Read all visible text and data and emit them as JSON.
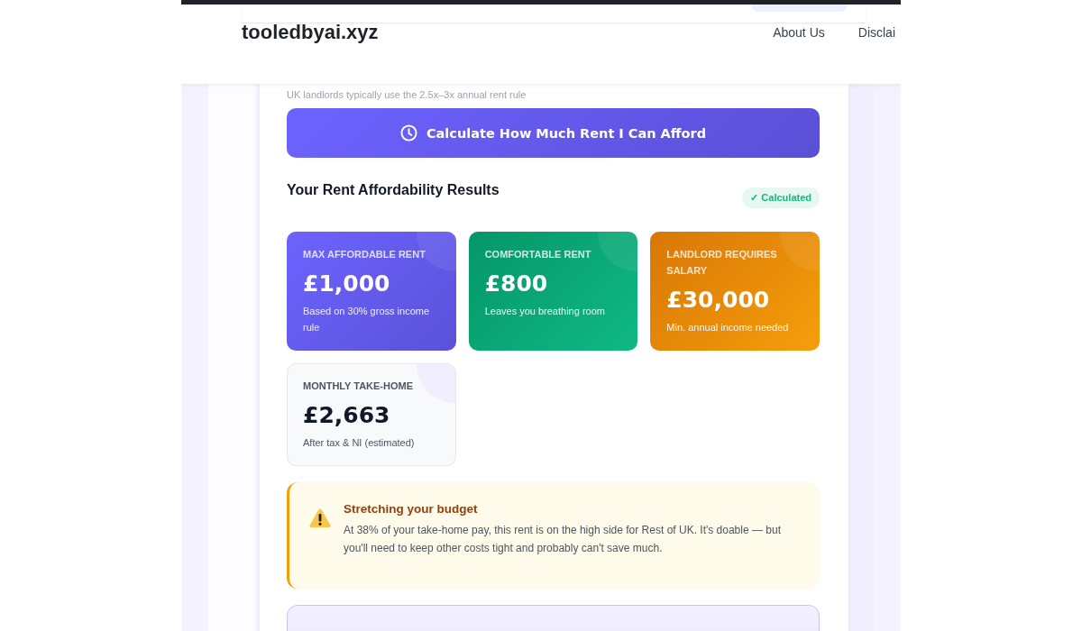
{
  "site_header": {
    "logo": "tooledbyai.xyz",
    "nav": [
      "About Us",
      "Disclai"
    ]
  },
  "calculator": {
    "hint": "UK landlords typically use the 2.5x–3x annual rent rule",
    "button": "Calculate How Much Rent I Can Afford"
  },
  "results": {
    "title": "Your Rent Affordability Results",
    "badge": "✓ Calculated",
    "cards": [
      {
        "kind": "primary",
        "label": "MAX AFFORDABLE RENT",
        "value": "£1,000",
        "note": "Based on 30% gross income rule"
      },
      {
        "kind": "success",
        "label": "COMFORTABLE RENT",
        "value": "£800",
        "note": "Leaves you breathing room"
      },
      {
        "kind": "warning",
        "label": "LANDLORD REQUIRES SALARY",
        "value": "£30,000",
        "note": "Min. annual income needed"
      },
      {
        "kind": "neutral",
        "label": "MONTHLY TAKE-HOME",
        "value": "£2,663",
        "note": "After tax & NI (estimated)"
      }
    ]
  },
  "alert": {
    "title": "Stretching your budget",
    "text": "At 38% of your take-home pay, this rent is on the high side for Rest of UK. It's doable — but you'll need to keep other costs tight and probably can't save much."
  }
}
